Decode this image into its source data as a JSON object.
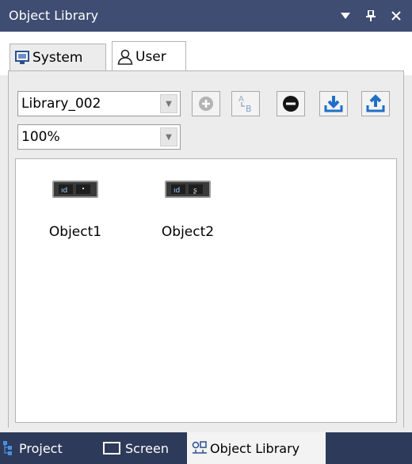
{
  "window": {
    "title": "Object Library",
    "controls": [
      "dropdown-icon",
      "pin-icon",
      "close-icon"
    ]
  },
  "tabs": [
    {
      "label": "System",
      "icon": "system-icon",
      "selected": false
    },
    {
      "label": "User",
      "icon": "user-icon",
      "selected": true
    }
  ],
  "library_select": {
    "value": "Library_002"
  },
  "zoom_select": {
    "value": "100%"
  },
  "toolbar": {
    "buttons": [
      "add-icon",
      "rename-icon",
      "remove-icon",
      "import-icon",
      "export-icon"
    ]
  },
  "objects": [
    {
      "label": "Object1"
    },
    {
      "label": "Object2"
    }
  ],
  "bottom_tabs": [
    {
      "label": "Project",
      "icon": "project-icon",
      "selected": false
    },
    {
      "label": "Screen",
      "icon": "screen-icon",
      "selected": false
    },
    {
      "label": "Object Library",
      "icon": "object-library-icon",
      "selected": true
    }
  ],
  "colors": {
    "titlebar": "#3f4d72",
    "bottombar": "#2e3a59",
    "accent_blue": "#1f6fc7",
    "panel_bg": "#ececec"
  }
}
